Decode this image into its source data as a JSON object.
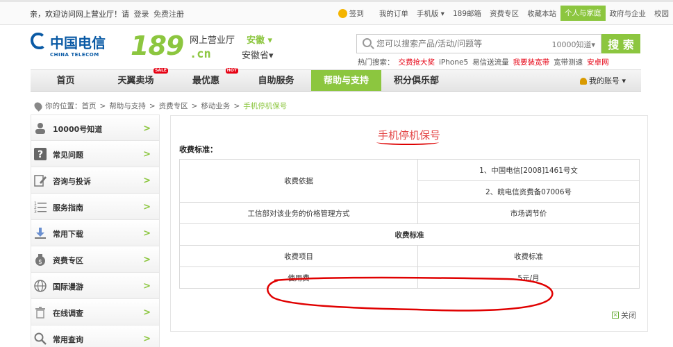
{
  "topbar": {
    "welcome": "亲，欢迎访问网上营业厅！请",
    "login": "登录",
    "register": "免费注册",
    "links": [
      "签到",
      "我的订单",
      "手机版 ▾",
      "189邮箱",
      "资费专区",
      "收藏本站",
      "个人与家庭",
      "政府与企业",
      "校园"
    ]
  },
  "header": {
    "ct_cn": "中国电信",
    "ct_en": "CHINA TELECOM",
    "brand_num": "189",
    "brand_suffix": ".cn",
    "hall": "网上营业厅",
    "province": "安徽 ▾",
    "province2": "安徽省▾",
    "search_placeholder": "您可以搜索产品/活动/问题等",
    "search_scope": "10000知道▾",
    "search_button": "搜 索",
    "hot_label": "热门搜索：",
    "hot_items": [
      "交费抢大奖",
      "iPhone5",
      "易信送流量",
      "我要装宽带",
      "宽带测速",
      "安卓网"
    ]
  },
  "nav": {
    "items": [
      {
        "label": "首页",
        "tag": ""
      },
      {
        "label": "天翼卖场",
        "tag": "SALE"
      },
      {
        "label": "最优惠",
        "tag": "HOT"
      },
      {
        "label": "自助服务",
        "tag": ""
      },
      {
        "label": "帮助与支持",
        "tag": ""
      },
      {
        "label": "积分俱乐部",
        "tag": ""
      }
    ],
    "account": "我的账号 ▾"
  },
  "breadcrumb": {
    "prefix": "你的位置：首页",
    "parts": [
      "帮助与支持",
      "资费专区",
      "移动业务"
    ],
    "current": "手机停机保号",
    "sep": ">"
  },
  "sidebar": {
    "items": [
      {
        "label": "10000号知道",
        "icon": "person-icon"
      },
      {
        "label": "常见问题",
        "icon": "question-icon"
      },
      {
        "label": "咨询与投诉",
        "icon": "edit-icon"
      },
      {
        "label": "服务指南",
        "icon": "list-icon"
      },
      {
        "label": "常用下载",
        "icon": "download-icon"
      },
      {
        "label": "资费专区",
        "icon": "moneybag-icon"
      },
      {
        "label": "国际漫游",
        "icon": "globe-icon"
      },
      {
        "label": "在线调查",
        "icon": "trash-icon"
      },
      {
        "label": "常用查询",
        "icon": "search-icon"
      }
    ],
    "arrow": ">"
  },
  "content": {
    "title": "手机停机保号",
    "std_label": "收费标准：",
    "rows": {
      "basis_label": "收费依据",
      "basis_1": "1、中国电信[2008]1461号文",
      "basis_2": "2、皖电信资费备07006号",
      "method_label": "工信部对该业务的价格管理方式",
      "method_value": "市场调节价",
      "section": "收费标准",
      "item_header": "收费项目",
      "std_header": "收费标准",
      "fee_label": "使用费",
      "fee_value": "5元/月"
    },
    "close": "关闭"
  },
  "colors": {
    "brand_green": "#8cc63f",
    "telecom_blue": "#0a5aa5",
    "annotation_red": "#e00000"
  }
}
